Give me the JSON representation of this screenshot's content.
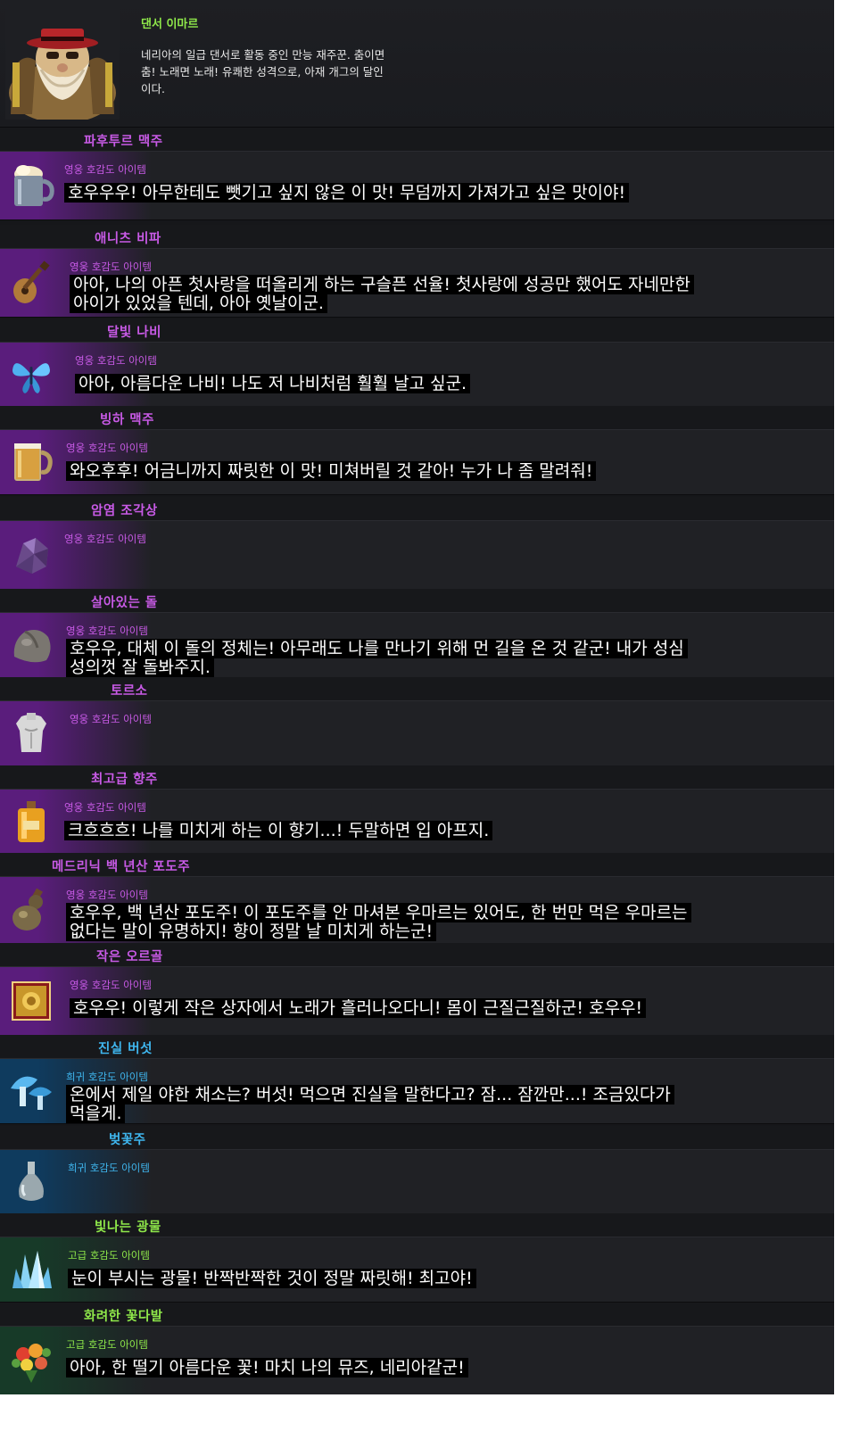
{
  "npc": {
    "name": "댄서 이마르",
    "description": "네리아의 일급 댄서로 활동 중인 만능 재주꾼. 춤이면 춤! 노래면 노래! 유쾌한 성격으로, 아재 개그의 달인이다."
  },
  "colors": {
    "title_hero": "#c85ae6",
    "title_rare": "#3fb6ee",
    "title_advanced": "#8fe84a",
    "glow_hero": "#5a1d7c",
    "glow_rare": "#0f3b5e",
    "glow_advanced": "#173a28"
  },
  "items": [
    {
      "title": "파후투르 맥주",
      "grade": "영웅 호감도 아이템",
      "tier": "hero",
      "icon": "beer-mug-foam-icon",
      "quote": "호우우우! 아무한테도 뺏기고 싶지 않은 이 맛! 무덤까지 가져가고 싶은 맛이야!"
    },
    {
      "title": "애니츠 비파",
      "grade": "영웅 호감도 아이템",
      "tier": "hero",
      "icon": "lute-icon",
      "quote": "아아, 나의 아픈 첫사랑을 떠올리게 하는 구슬픈 선율! 첫사랑에 성공만 했어도 자네만한 아이가 있었을 텐데, 아아 옛날이군."
    },
    {
      "title": "달빛 나비",
      "grade": "영웅 호감도 아이템",
      "tier": "hero",
      "icon": "butterfly-icon",
      "quote": "아아, 아름다운 나비! 나도 저 나비처럼 훨훨 날고 싶군."
    },
    {
      "title": "빙하 맥주",
      "grade": "영웅 호감도 아이템",
      "tier": "hero",
      "icon": "beer-mug-icon",
      "quote": "와오후후! 어금니까지 짜릿한 이 맛! 미쳐버릴 것 같아! 누가 나 좀 말려줘!"
    },
    {
      "title": "암염 조각상",
      "grade": "영웅 호감도 아이템",
      "tier": "hero",
      "icon": "crystal-rock-icon",
      "quote": ""
    },
    {
      "title": "살아있는 돌",
      "grade": "영웅 호감도 아이템",
      "tier": "hero",
      "icon": "stone-icon",
      "quote": "호우우, 대체 이 돌의 정체는! 아무래도 나를 만나기 위해 먼 길을 온 것 같군! 내가 성심성의껏 잘 돌봐주지."
    },
    {
      "title": "토르소",
      "grade": "영웅 호감도 아이템",
      "tier": "hero",
      "icon": "torso-icon",
      "quote": ""
    },
    {
      "title": "최고급 향주",
      "grade": "영웅 호감도 아이템",
      "tier": "hero",
      "icon": "liquor-bottle-icon",
      "quote": "크흐흐흐! 나를 미치게 하는 이 향기...! 두말하면 입 아프지."
    },
    {
      "title": "메드리닉 백 년산 포도주",
      "grade": "영웅 호감도 아이템",
      "tier": "hero",
      "icon": "wine-gourd-icon",
      "quote": "호우우, 백 년산 포도주! 이 포도주를 안 마셔본 우마르는 있어도, 한 번만 먹은 우마르는 없다는 말이 유명하지! 향이 정말 날 미치게 하는군!"
    },
    {
      "title": "작은 오르골",
      "grade": "영웅 호감도 아이템",
      "tier": "hero",
      "icon": "music-box-icon",
      "quote": "호우우! 이렇게 작은 상자에서 노래가 흘러나오다니! 몸이 근질근질하군! 호우우!"
    },
    {
      "title": "진실 버섯",
      "grade": "희귀 호감도 아이템",
      "tier": "rare",
      "icon": "mushroom-icon",
      "quote": "온에서 제일 야한 채소는? 버섯! 먹으면 진실을 말한다고? 잠... 잠깐만...! 조금있다가 먹을게."
    },
    {
      "title": "벚꽃주",
      "grade": "희귀 호감도 아이템",
      "tier": "rare",
      "icon": "flask-icon",
      "quote": ""
    },
    {
      "title": "빛나는 광물",
      "grade": "고급 호감도 아이템",
      "tier": "advanced",
      "icon": "crystal-cluster-icon",
      "quote": "눈이 부시는 광물! 반짝반짝한 것이 정말 짜릿해! 최고야!"
    },
    {
      "title": "화려한 꽃다발",
      "grade": "고급 호감도 아이템",
      "tier": "advanced",
      "icon": "flower-bouquet-icon",
      "quote": "아아, 한 떨기 아름다운 꽃! 마치 나의 뮤즈, 네리아같군!"
    }
  ]
}
